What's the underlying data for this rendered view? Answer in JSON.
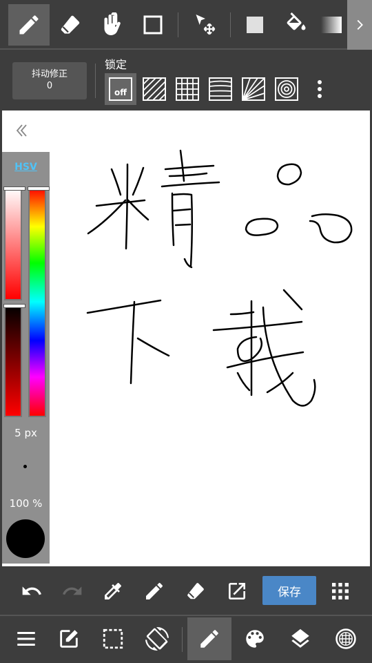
{
  "toolbar": {
    "tools": [
      "pen",
      "eraser",
      "hand",
      "rectangle",
      "move",
      "fill-color",
      "bucket",
      "gradient"
    ],
    "active_tool": "pen"
  },
  "options": {
    "stabilizer_label": "抖动修正",
    "stabilizer_value": "0",
    "lock_label": "锁定",
    "lock_off_label": "off"
  },
  "color_panel": {
    "mode_label": "HSV",
    "brush_size": "5 px",
    "opacity": "100 %",
    "current_color": "#000000"
  },
  "action_bar": {
    "save_label": "保存"
  },
  "colors": {
    "background": "#3d3d3d",
    "active_tool": "#5f5f5f",
    "save_button": "#4a87c7",
    "hsv_label": "#4fc3f7"
  }
}
